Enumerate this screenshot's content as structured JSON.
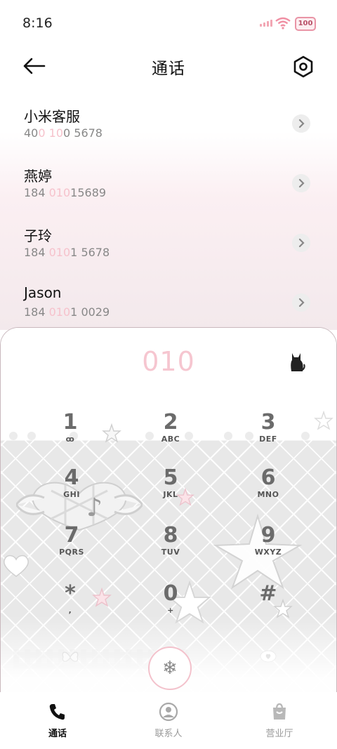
{
  "status_bar": {
    "time": "8:16",
    "battery": "100"
  },
  "header": {
    "title": "通话"
  },
  "results": [
    {
      "name": "小米客服",
      "number_parts": [
        "40",
        "0",
        " ",
        "10",
        "0 5678"
      ]
    },
    {
      "name": "燕婷",
      "number_parts": [
        "184 ",
        "010",
        "15689"
      ]
    },
    {
      "name": "子玲",
      "number_parts": [
        "184 ",
        "010",
        "1 5678"
      ]
    },
    {
      "name": "Jason",
      "number_parts": [
        "184 ",
        "010",
        "1 0029"
      ]
    }
  ],
  "dialer": {
    "entered": "010",
    "keys": [
      {
        "digit": "1",
        "letters": "ꝏ"
      },
      {
        "digit": "2",
        "letters": "ABC"
      },
      {
        "digit": "3",
        "letters": "DEF"
      },
      {
        "digit": "4",
        "letters": "GHI"
      },
      {
        "digit": "5",
        "letters": "JKL"
      },
      {
        "digit": "6",
        "letters": "MNO"
      },
      {
        "digit": "7",
        "letters": "PQRS"
      },
      {
        "digit": "8",
        "letters": "TUV"
      },
      {
        "digit": "9",
        "letters": "WXYZ"
      },
      {
        "digit": "*",
        "letters": ","
      },
      {
        "digit": "0",
        "letters": "+"
      },
      {
        "digit": "#",
        "letters": ""
      }
    ],
    "call_icon": "snowflake-icon"
  },
  "nav": [
    {
      "label": "通话",
      "icon": "phone-icon",
      "active": true
    },
    {
      "label": "联系人",
      "icon": "contact-icon",
      "active": false
    },
    {
      "label": "营业厅",
      "icon": "shop-bag-icon",
      "active": false
    }
  ],
  "colors": {
    "highlight": "#f6c2cc",
    "accent_pink": "#f3c2cc",
    "active_nav": "#111111",
    "inactive_nav": "#9a9a9a"
  }
}
